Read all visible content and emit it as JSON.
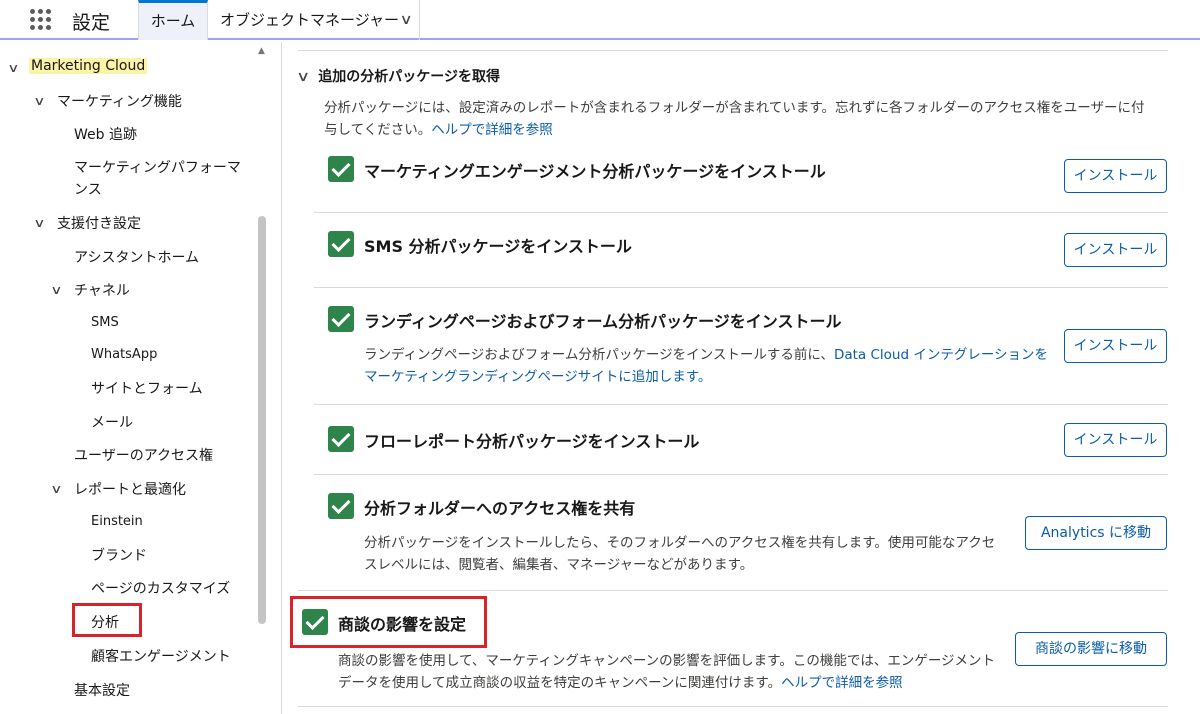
{
  "header": {
    "app_title": "設定",
    "tab_home": "ホーム",
    "tab_object_manager": "オブジェクトマネージャー",
    "chevron": "⌄"
  },
  "sidebar": {
    "marketing_cloud": "Marketing Cloud",
    "marketing_features": "マーケティング機能",
    "web_tracking": "Web 追跡",
    "marketing_performance_line1": "マーケティングパフォーマ",
    "marketing_performance_line2": "ンス",
    "guided_setup": "支援付き設定",
    "assistant_home": "アシスタントホーム",
    "channels": "チャネル",
    "sms": "SMS",
    "whatsapp": "WhatsApp",
    "sites_forms": "サイトとフォーム",
    "email": "メール",
    "user_access": "ユーザーのアクセス権",
    "reports_optimization": "レポートと最適化",
    "einstein": "Einstein",
    "brand": "ブランド",
    "page_customize": "ページのカスタマイズ",
    "analytics": "分析",
    "customer_engagement": "顧客エンゲージメント",
    "basic_settings": "基本設定"
  },
  "main": {
    "section_title": "追加の分析パッケージを取得",
    "section_desc": "分析パッケージには、設定済みのレポートが含まれるフォルダーが含まれています。忘れずに各フォルダーのアクセス権をユーザーに付与してください。",
    "section_link": "ヘルプで詳細を参照",
    "items": [
      {
        "title": "マーケティングエンゲージメント分析パッケージをインストール",
        "button": "インストール"
      },
      {
        "title": "SMS 分析パッケージをインストール",
        "button": "インストール"
      },
      {
        "title": "ランディングページおよびフォーム分析パッケージをインストール",
        "desc": "ランディングページおよびフォーム分析パッケージをインストールする前に、",
        "desc_link": "Data Cloud インテグレーションをマーケティングランディングページサイトに追加します。",
        "button": "インストール"
      },
      {
        "title": "フローレポート分析パッケージをインストール",
        "button": "インストール"
      },
      {
        "title": "分析フォルダーへのアクセス権を共有",
        "desc": "分析パッケージをインストールしたら、そのフォルダーへのアクセス権を共有します。使用可能なアクセスレベルには、閲覧者、編集者、マネージャーなどがあります。",
        "button": "Analytics に移動"
      },
      {
        "title": "商談の影響を設定",
        "desc": "商談の影響を使用して、マーケティングキャンペーンの影響を評価します。この機能では、エンゲージメントデータを使用して成立商談の収益を特定のキャンペーンに関連付けます。",
        "desc_link": "ヘルプで詳細を参照",
        "button": "商談の影響に移動"
      }
    ]
  }
}
